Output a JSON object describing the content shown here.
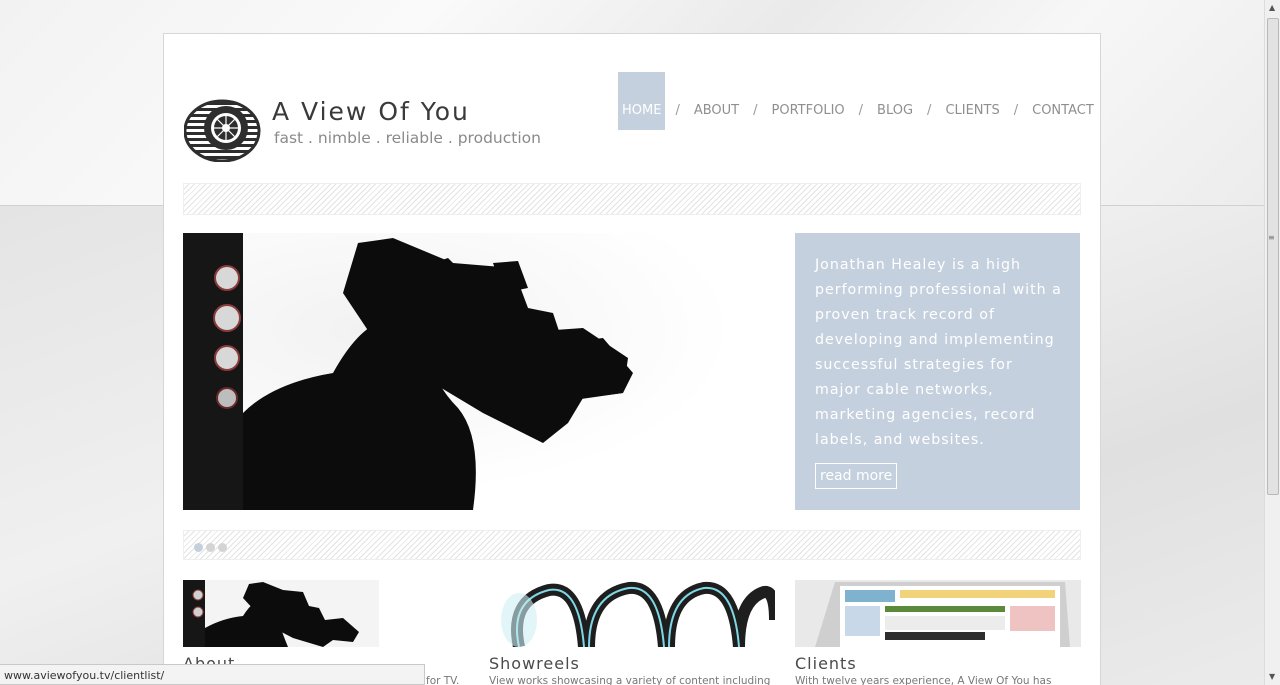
{
  "site": {
    "logo_title": "A View Of You",
    "logo_tagline": "fast . nimble . reliable . production"
  },
  "nav": {
    "items": [
      "HOME",
      "ABOUT",
      "PORTFOLIO",
      "BLOG",
      "CLIENTS",
      "CONTACT"
    ],
    "separator": "/",
    "active": "HOME"
  },
  "hero": {
    "text": "Jonathan Healey is a high performing professional with a proven track record of developing and implementing successful strategies for major cable networks, marketing agencies, record labels, and websites.",
    "read_more": "read more"
  },
  "slider": {
    "slide_count": 3,
    "active_index": 0
  },
  "cards": [
    {
      "title": "About",
      "text": "n for TV."
    },
    {
      "title": "Showreels",
      "text": "View works showcasing a variety of content including"
    },
    {
      "title": "Clients",
      "text": "With twelve years experience, A View Of You has"
    }
  ],
  "status_bar": {
    "url": "www.aviewofyou.tv/clientlist/"
  },
  "colors": {
    "accent": "#c5d0de",
    "nav_text": "#8f8f8f",
    "page_bg": "#e6e6e6"
  }
}
